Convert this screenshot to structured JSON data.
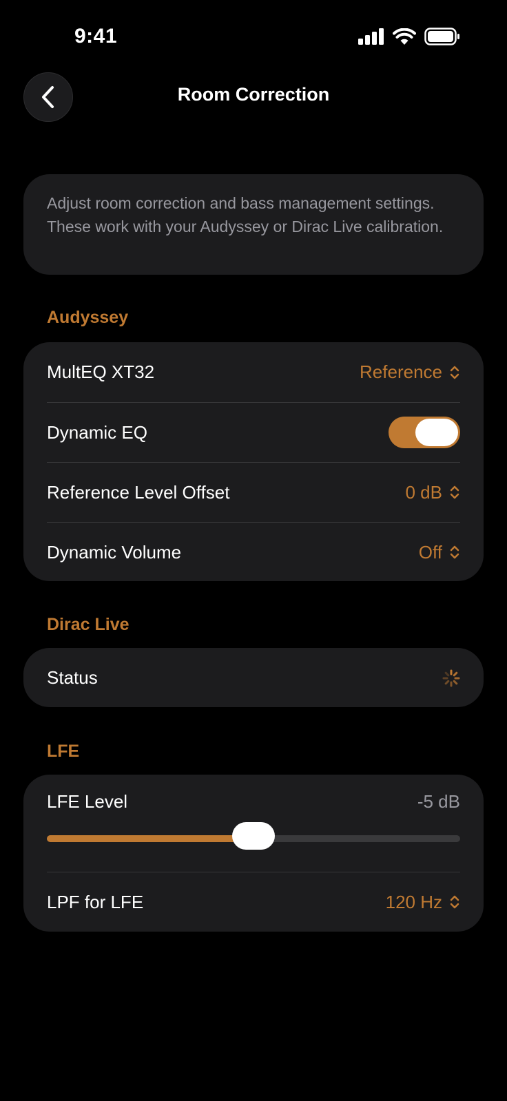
{
  "status_bar": {
    "time": "9:41"
  },
  "nav": {
    "title": "Room Correction"
  },
  "intro": {
    "text": "Adjust room correction and bass management settings. These work with your Audyssey or Dirac Live calibration."
  },
  "audyssey": {
    "header": "Audyssey",
    "multeq": {
      "label": "MultEQ XT32",
      "value": "Reference"
    },
    "dynamic_eq": {
      "label": "Dynamic EQ",
      "on": true
    },
    "ref_offset": {
      "label": "Reference Level Offset",
      "value": "0 dB"
    },
    "dynamic_volume": {
      "label": "Dynamic Volume",
      "value": "Off"
    }
  },
  "dirac": {
    "header": "Dirac Live",
    "status": {
      "label": "Status"
    }
  },
  "lfe": {
    "header": "LFE",
    "level": {
      "label": "LFE Level",
      "value": "-5 dB",
      "fraction": 0.5
    },
    "lpf": {
      "label": "LPF for LFE",
      "value": "120 Hz"
    }
  },
  "colors": {
    "accent": "#c07a32",
    "card": "#1c1c1e",
    "background": "#000000",
    "secondary_text": "#98989f"
  }
}
